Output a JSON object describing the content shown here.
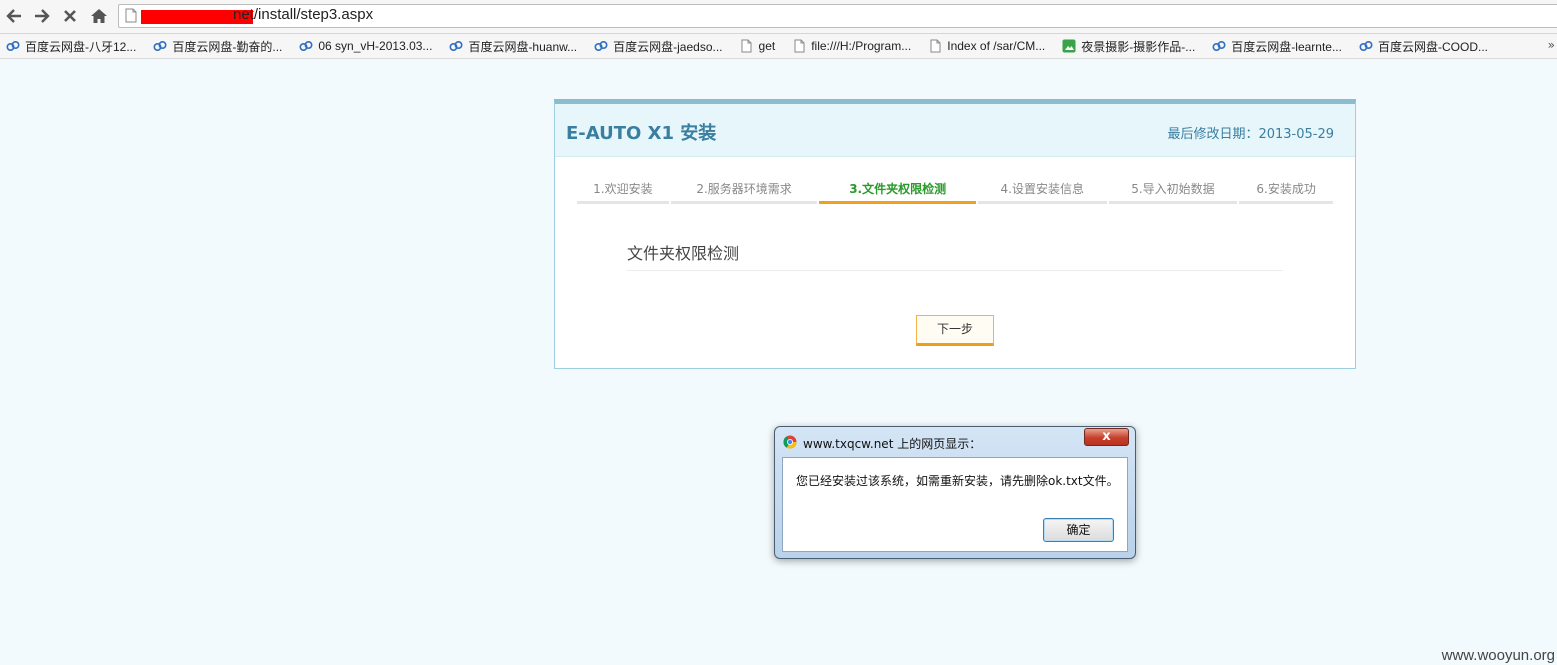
{
  "browser": {
    "url_visible": "net/install/step3.aspx",
    "bookmarks": [
      {
        "label": "百度云网盘-八牙12...",
        "icon": "baidu-cloud-icon"
      },
      {
        "label": "百度云网盘-勤奋的...",
        "icon": "baidu-cloud-icon"
      },
      {
        "label": "06 syn_vH-2013.03...",
        "icon": "baidu-cloud-icon"
      },
      {
        "label": "百度云网盘-huanw...",
        "icon": "baidu-cloud-icon"
      },
      {
        "label": "百度云网盘-jaedso...",
        "icon": "baidu-cloud-icon"
      },
      {
        "label": "get",
        "icon": "page-icon"
      },
      {
        "label": "file:///H:/Program...",
        "icon": "page-icon"
      },
      {
        "label": "Index of /sar/CM...",
        "icon": "page-icon"
      },
      {
        "label": "夜景摄影-摄影作品-...",
        "icon": "photo-site-icon"
      },
      {
        "label": "百度云网盘-learnte...",
        "icon": "baidu-cloud-icon"
      },
      {
        "label": "百度云网盘-COOD...",
        "icon": "baidu-cloud-icon"
      }
    ]
  },
  "panel": {
    "title": "E-AUTO X1 安装",
    "date_label": "最后修改日期：2013-05-29",
    "steps": [
      {
        "label": "1.欢迎安装",
        "active": false
      },
      {
        "label": "2.服务器环境需求",
        "active": false
      },
      {
        "label": "3.文件夹权限检测",
        "active": true
      },
      {
        "label": "4.设置安装信息",
        "active": false
      },
      {
        "label": "5.导入初始数据",
        "active": false
      },
      {
        "label": "6.安装成功",
        "active": false
      }
    ],
    "section_title": "文件夹权限检测",
    "next_button": "下一步"
  },
  "dialog": {
    "title": "www.txqcw.net 上的网页显示：",
    "message": "您已经安装过该系统，如需重新安装，请先删除ok.txt文件。",
    "ok_button": "确定",
    "close_glyph": "x"
  },
  "watermark": "www.wooyun.org",
  "colors": {
    "page_bg": "#f3fafd",
    "panel_accent": "#3a7ea0",
    "active_step_text": "#2a9a2a",
    "active_step_underline": "#f0a020",
    "redaction": "#ff0000"
  }
}
